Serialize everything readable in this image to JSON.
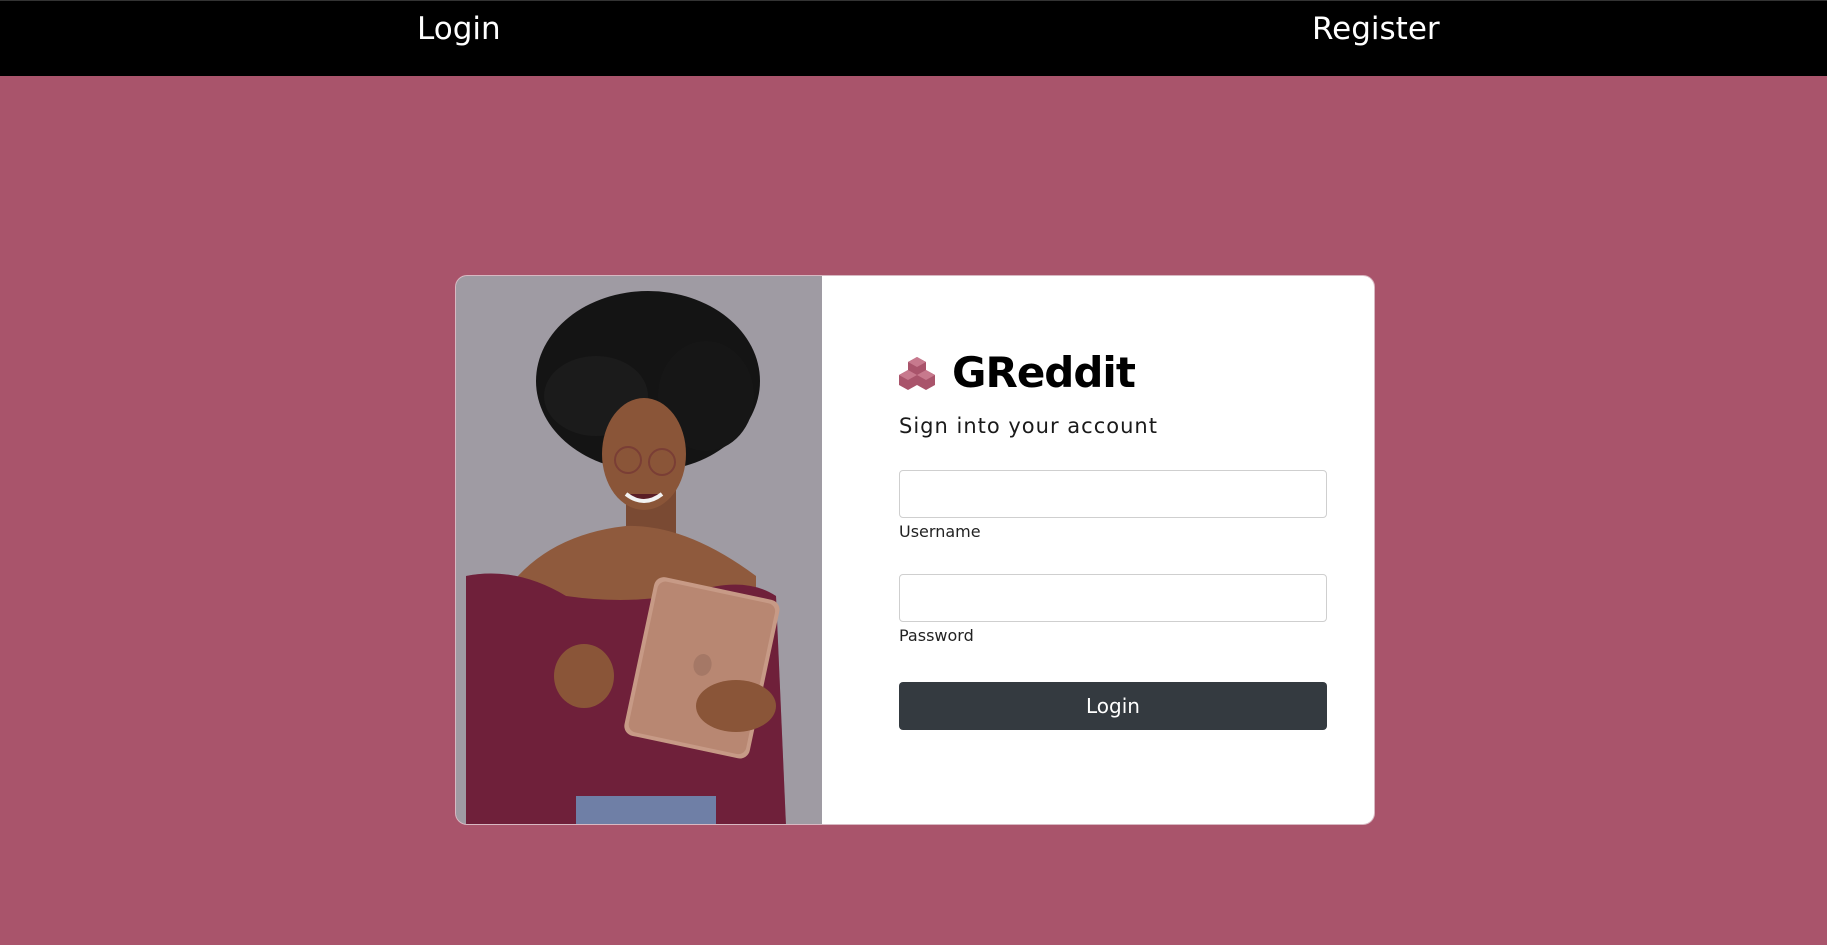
{
  "nav": {
    "login_label": "Login",
    "register_label": "Register"
  },
  "login_form": {
    "brand_icon": "cubes-icon",
    "brand_name": "GReddit",
    "subtitle": "Sign into your account",
    "username": {
      "label": "Username",
      "value": "",
      "placeholder": ""
    },
    "password": {
      "label": "Password",
      "value": "",
      "placeholder": ""
    },
    "submit_label": "Login"
  },
  "colors": {
    "page_background": "#a9546b",
    "nav_background": "#000000",
    "brand_accent": "#a9546b",
    "button_background": "#343a40"
  }
}
